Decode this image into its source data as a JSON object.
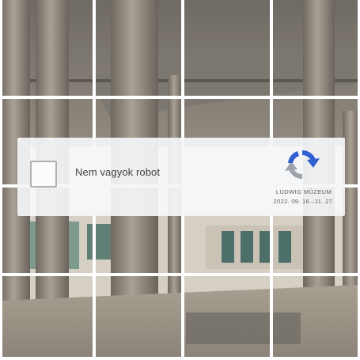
{
  "captcha": {
    "checkbox_label": "Nem vagyok robot",
    "checked": false,
    "brand": "LUDWIG MÚZEUM",
    "dates": "2022. 09. 16.–11. 27."
  },
  "icons": {
    "logo": "recaptcha-arrows-icon",
    "checkbox": "empty-checkbox"
  },
  "colors": {
    "logo_blue": "#2f5fd0",
    "logo_gray": "#9ea3ab",
    "grid_lines": "#ffffff",
    "panel": "#f4f5f7"
  },
  "grid": {
    "rows": 4,
    "cols": 4
  }
}
